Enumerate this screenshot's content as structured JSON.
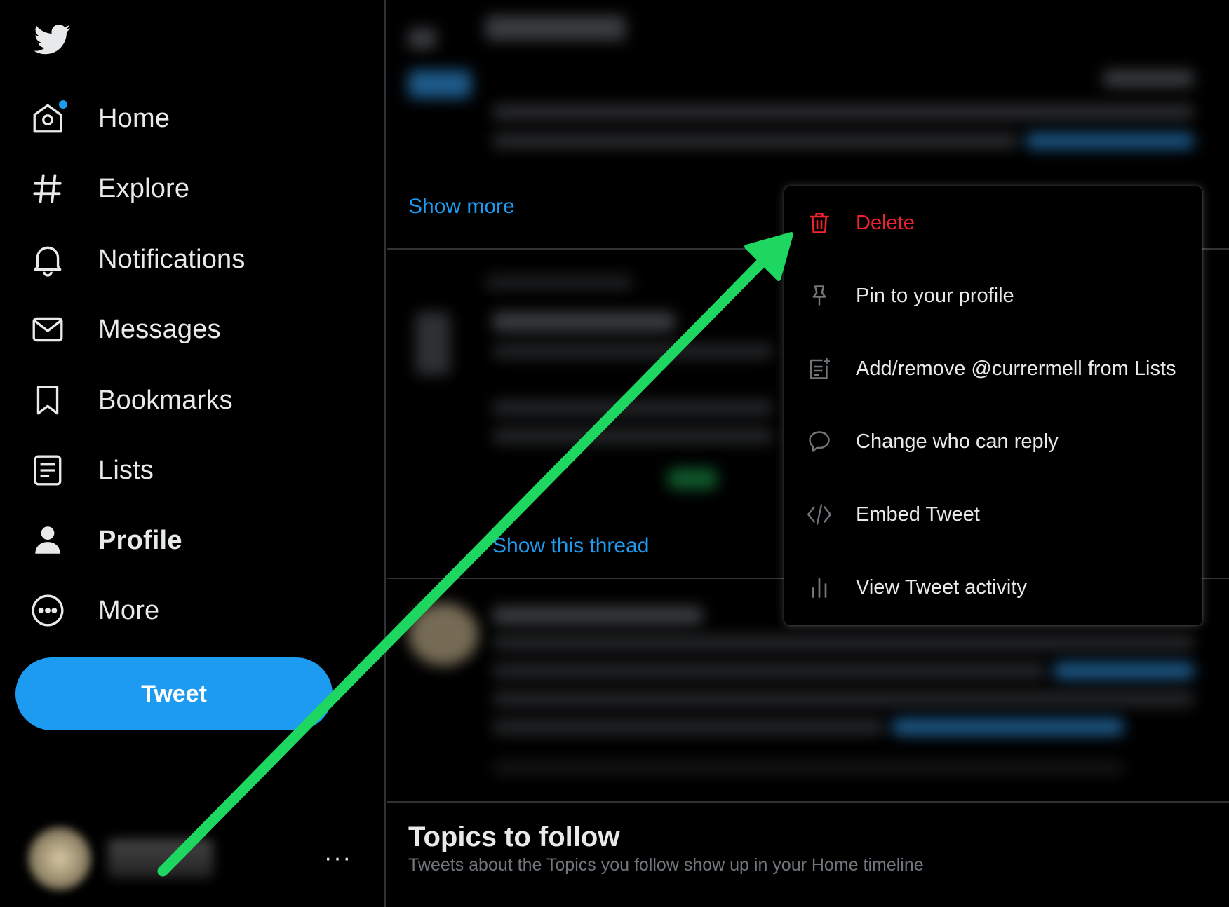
{
  "colors": {
    "accent": "#1d9bf0",
    "danger": "#f4212e",
    "background": "#000000",
    "text": "#e7e9ea",
    "muted": "#71767b",
    "annotation_arrow": "#1ed760"
  },
  "sidebar": {
    "logo_icon": "twitter-bird-icon",
    "items": [
      {
        "label": "Home",
        "icon": "home-icon"
      },
      {
        "label": "Explore",
        "icon": "hashtag-icon"
      },
      {
        "label": "Notifications",
        "icon": "bell-icon"
      },
      {
        "label": "Messages",
        "icon": "envelope-icon"
      },
      {
        "label": "Bookmarks",
        "icon": "bookmark-icon"
      },
      {
        "label": "Lists",
        "icon": "list-icon"
      },
      {
        "label": "Profile",
        "icon": "person-icon"
      },
      {
        "label": "More",
        "icon": "more-circle-icon"
      }
    ],
    "tweet_button": "Tweet",
    "account_more": "···"
  },
  "timeline": {
    "show_more": "Show more",
    "show_this_thread": "Show this thread",
    "topics": {
      "title": "Topics to follow",
      "subtitle": "Tweets about the Topics you follow show up in your Home timeline"
    }
  },
  "tweet_menu": {
    "items": [
      {
        "label": "Delete",
        "icon": "trash-icon"
      },
      {
        "label": "Pin to your profile",
        "icon": "pin-icon"
      },
      {
        "label": "Add/remove @currermell from Lists",
        "icon": "add-list-icon"
      },
      {
        "label": "Change who can reply",
        "icon": "speech-bubble-icon"
      },
      {
        "label": "Embed Tweet",
        "icon": "code-icon"
      },
      {
        "label": "View Tweet activity",
        "icon": "bar-chart-icon"
      }
    ]
  }
}
